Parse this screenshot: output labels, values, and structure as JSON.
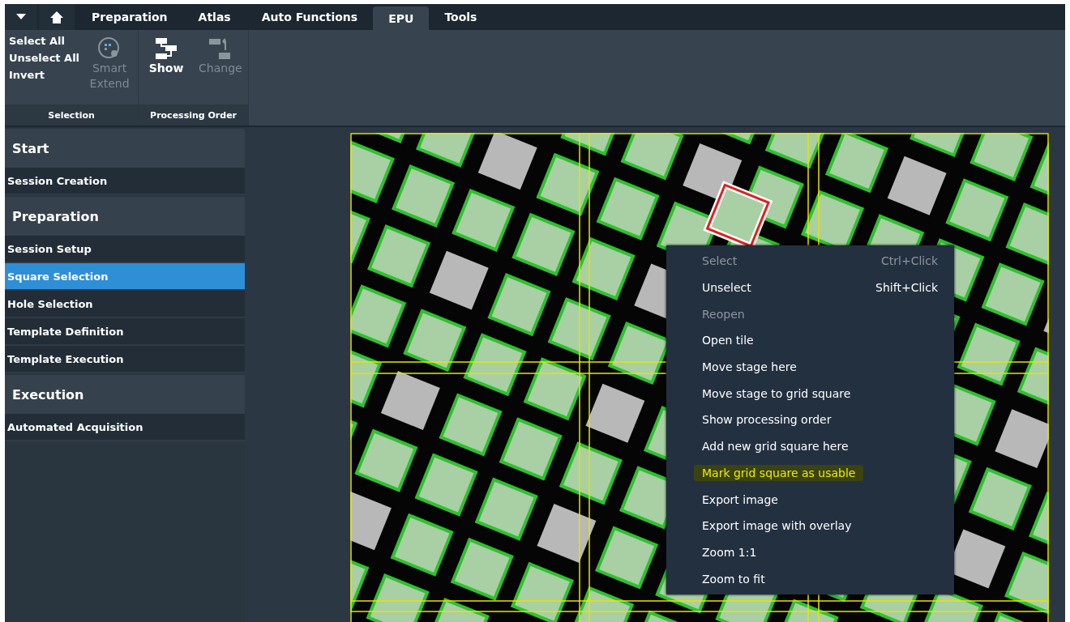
{
  "tabs": [
    {
      "label": "Preparation",
      "selected": false
    },
    {
      "label": "Atlas",
      "selected": false
    },
    {
      "label": "Auto Functions",
      "selected": false
    },
    {
      "label": "EPU",
      "selected": true
    },
    {
      "label": "Tools",
      "selected": false
    }
  ],
  "ribbon": {
    "groups": [
      {
        "title": "Selection",
        "links": [
          "Select All",
          "Unselect All",
          "Invert"
        ],
        "buttons": [
          {
            "label": "Smart Extend",
            "kind": "smart",
            "disabled": true
          }
        ]
      },
      {
        "title": "Processing Order",
        "buttons": [
          {
            "label": "Show",
            "kind": "show",
            "disabled": false
          },
          {
            "label": "Change",
            "kind": "change",
            "disabled": true
          }
        ]
      }
    ]
  },
  "sidebar": {
    "sections": [
      {
        "title": "Start",
        "items": [
          {
            "label": "Session Creation",
            "selected": false
          }
        ]
      },
      {
        "title": "Preparation",
        "items": [
          {
            "label": "Session Setup",
            "selected": false
          },
          {
            "label": "Square Selection",
            "selected": true
          },
          {
            "label": "Hole Selection",
            "selected": false
          },
          {
            "label": "Template Definition",
            "selected": false
          },
          {
            "label": "Template Execution",
            "selected": false
          }
        ]
      },
      {
        "title": "Execution",
        "items": [
          {
            "label": "Automated Acquisition",
            "selected": false
          }
        ]
      }
    ]
  },
  "context_menu": {
    "items": [
      {
        "label": "Select",
        "shortcut": "Ctrl+Click",
        "disabled": true,
        "highlighted": false
      },
      {
        "label": "Unselect",
        "shortcut": "Shift+Click",
        "disabled": false,
        "highlighted": false
      },
      {
        "label": "Reopen",
        "disabled": true,
        "highlighted": false
      },
      {
        "label": "Open tile",
        "disabled": false,
        "highlighted": false
      },
      {
        "label": "Move stage here",
        "disabled": false,
        "highlighted": false
      },
      {
        "label": "Move stage to grid square",
        "disabled": false,
        "highlighted": false
      },
      {
        "label": "Show processing order",
        "disabled": false,
        "highlighted": false
      },
      {
        "label": "Add new grid square here",
        "disabled": false,
        "highlighted": false
      },
      {
        "label": "Mark grid square as usable",
        "disabled": false,
        "highlighted": true
      },
      {
        "label": "Export image",
        "disabled": false,
        "highlighted": false
      },
      {
        "label": "Export image with overlay",
        "disabled": false,
        "highlighted": false
      },
      {
        "label": "Zoom 1:1",
        "disabled": false,
        "highlighted": false
      },
      {
        "label": "Zoom to fit",
        "disabled": false,
        "highlighted": false
      }
    ]
  }
}
